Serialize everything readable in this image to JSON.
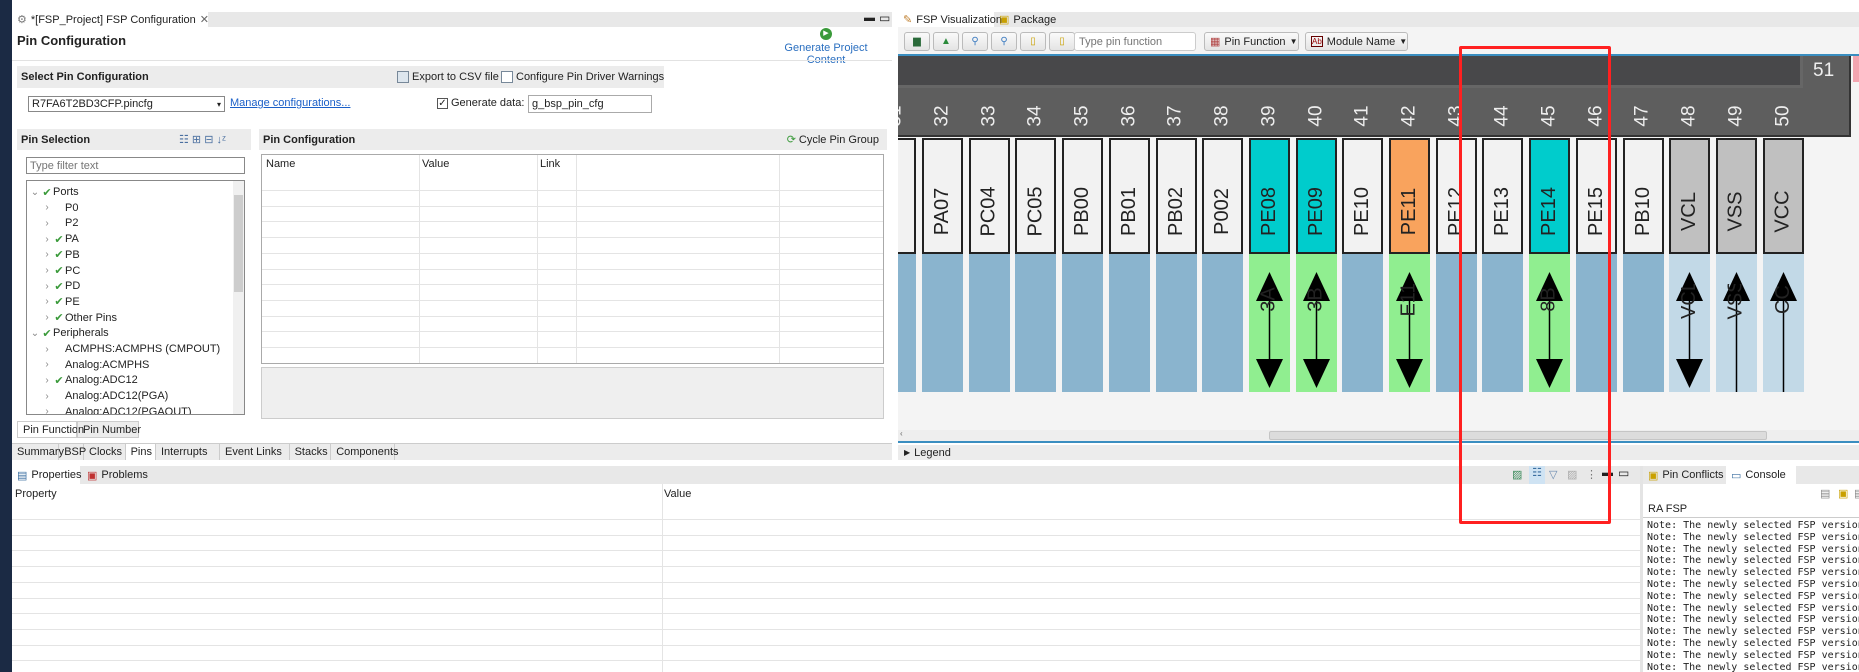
{
  "editor_tab": {
    "title": "*[FSP_Project] FSP Configuration",
    "close": "✕"
  },
  "page_title": "Pin Configuration",
  "generate_label": "Generate Project Content",
  "select_section": {
    "title": "Select Pin Configuration",
    "export": "Export to CSV file",
    "warnings": "Configure Pin Driver Warnings",
    "config_value": "R7FA6T2BD3CFP.pincfg",
    "manage": "Manage configurations...",
    "generate_data_label": "Generate data:",
    "generate_data_checked": true,
    "generate_data_value": "g_bsp_pin_cfg"
  },
  "pin_selection": {
    "title": "Pin Selection",
    "filter_placeholder": "Type filter text",
    "tree": [
      {
        "label": "Ports",
        "level": 0,
        "expanded": true,
        "checked": true
      },
      {
        "label": "P0",
        "level": 1,
        "checked": false
      },
      {
        "label": "P2",
        "level": 1,
        "checked": false
      },
      {
        "label": "PA",
        "level": 1,
        "checked": true
      },
      {
        "label": "PB",
        "level": 1,
        "checked": true
      },
      {
        "label": "PC",
        "level": 1,
        "checked": true
      },
      {
        "label": "PD",
        "level": 1,
        "checked": true
      },
      {
        "label": "PE",
        "level": 1,
        "checked": true
      },
      {
        "label": "Other Pins",
        "level": 1,
        "checked": true
      },
      {
        "label": "Peripherals",
        "level": 0,
        "expanded": true,
        "checked": true
      },
      {
        "label": "ACMPHS:ACMPHS (CMPOUT)",
        "level": 1,
        "checked": false
      },
      {
        "label": "Analog:ACMPHS",
        "level": 1,
        "checked": false
      },
      {
        "label": "Analog:ADC12",
        "level": 1,
        "checked": true
      },
      {
        "label": "Analog:ADC12(PGA)",
        "level": 1,
        "checked": false
      },
      {
        "label": "Analog:ADC12(PGAOUT)",
        "level": 1,
        "checked": false
      }
    ],
    "tabs": [
      "Pin Function",
      "Pin Number"
    ]
  },
  "pin_config": {
    "title": "Pin Configuration",
    "cycle": "Cycle Pin Group",
    "columns": [
      "Name",
      "Value",
      "Link"
    ]
  },
  "editor_tabs": [
    "Summary",
    "BSP",
    "Clocks",
    "Pins",
    "Interrupts",
    "Event Links",
    "Stacks",
    "Components"
  ],
  "editor_tabs_active": "Pins",
  "viz": {
    "tabs": [
      "FSP Visualization",
      "Package"
    ],
    "search_placeholder": "Type pin function",
    "pin_function": "Pin Function",
    "module_name": "Module Name",
    "corner_pin": "51",
    "legend": "Legend",
    "colors": {
      "unused": "#f2f2f2",
      "cyan": "#00cccc",
      "orange": "#f9a35d",
      "power": "#c0c0c0",
      "func_blue": "#8ab4ce",
      "func_green": "#90ee90",
      "func_light": "#c2d9e7"
    },
    "pins": [
      {
        "num": "31",
        "name": "",
        "box": "unused",
        "func": "func_blue",
        "arrow": "none",
        "label": ""
      },
      {
        "num": "32",
        "name": "PA07",
        "box": "unused",
        "func": "func_blue",
        "arrow": "none",
        "label": ""
      },
      {
        "num": "33",
        "name": "PC04",
        "box": "unused",
        "func": "func_blue",
        "arrow": "none",
        "label": ""
      },
      {
        "num": "34",
        "name": "PC05",
        "box": "unused",
        "func": "func_blue",
        "arrow": "none",
        "label": ""
      },
      {
        "num": "35",
        "name": "PB00",
        "box": "unused",
        "func": "func_blue",
        "arrow": "none",
        "label": ""
      },
      {
        "num": "36",
        "name": "PB01",
        "box": "unused",
        "func": "func_blue",
        "arrow": "none",
        "label": ""
      },
      {
        "num": "37",
        "name": "PB02",
        "box": "unused",
        "func": "func_blue",
        "arrow": "none",
        "label": ""
      },
      {
        "num": "38",
        "name": "P002",
        "box": "unused",
        "func": "func_blue",
        "arrow": "none",
        "label": ""
      },
      {
        "num": "39",
        "name": "PE08",
        "box": "cyan",
        "func": "func_green",
        "arrow": "both",
        "label": "3A"
      },
      {
        "num": "40",
        "name": "PE09",
        "box": "cyan",
        "func": "func_green",
        "arrow": "both",
        "label": "3B"
      },
      {
        "num": "41",
        "name": "PE10",
        "box": "unused",
        "func": "func_blue",
        "arrow": "none",
        "label": ""
      },
      {
        "num": "42",
        "name": "PE11",
        "box": "orange",
        "func": "func_green",
        "arrow": "both",
        "label": "E11"
      },
      {
        "num": "43",
        "name": "PE12",
        "box": "unused",
        "func": "func_blue",
        "arrow": "none",
        "label": ""
      },
      {
        "num": "44",
        "name": "PE13",
        "box": "unused",
        "func": "func_blue",
        "arrow": "none",
        "label": ""
      },
      {
        "num": "45",
        "name": "PE14",
        "box": "cyan",
        "func": "func_green",
        "arrow": "both",
        "label": "8B"
      },
      {
        "num": "46",
        "name": "PE15",
        "box": "unused",
        "func": "func_blue",
        "arrow": "none",
        "label": ""
      },
      {
        "num": "47",
        "name": "PB10",
        "box": "unused",
        "func": "func_blue",
        "arrow": "none",
        "label": ""
      },
      {
        "num": "48",
        "name": "VCL",
        "box": "power",
        "func": "func_light",
        "arrow": "both",
        "label": "VCL"
      },
      {
        "num": "49",
        "name": "VSS",
        "box": "power",
        "func": "func_light",
        "arrow": "up",
        "label": "VSS"
      },
      {
        "num": "50",
        "name": "VCC",
        "box": "power",
        "func": "func_light",
        "arrow": "up",
        "label": "CC"
      }
    ]
  },
  "bottom": {
    "tabs": [
      "Properties",
      "Problems"
    ],
    "columns": [
      "Property",
      "Value"
    ]
  },
  "console": {
    "tabs": [
      "Pin Conflicts",
      "Console"
    ],
    "title": "RA FSP",
    "lines": [
      "Note: The newly selected FSP version re",
      "Note: The newly selected FSP version re",
      "Note: The newly selected FSP version re",
      "Note: The newly selected FSP version re",
      "Note: The newly selected FSP version re",
      "Note: The newly selected FSP version re",
      "Note: The newly selected FSP version re",
      "Note: The newly selected FSP version re",
      "Note: The newly selected FSP version re",
      "Note: The newly selected FSP version re",
      "Note: The newly selected FSP version re",
      "Note: The newly selected FSP version re",
      "Note: The newly selected FSP version re"
    ]
  },
  "highlight_color": "#ff2020"
}
